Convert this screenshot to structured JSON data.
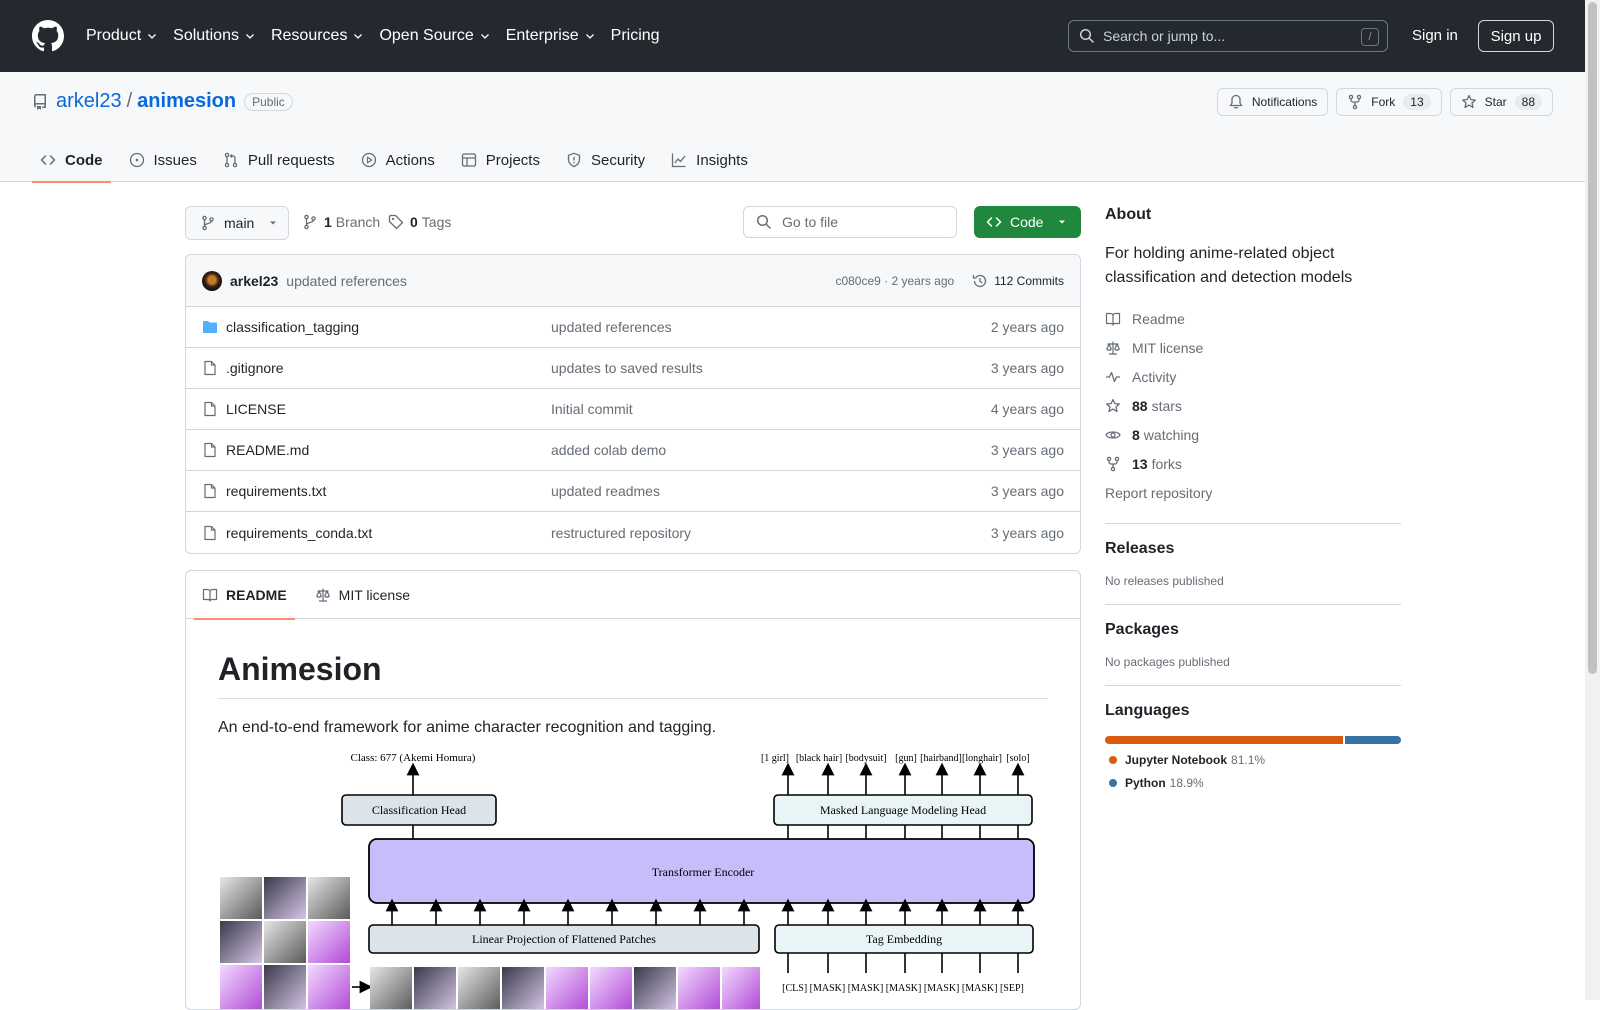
{
  "nav": {
    "items": [
      "Product",
      "Solutions",
      "Resources",
      "Open Source",
      "Enterprise",
      "Pricing"
    ],
    "search_placeholder": "Search or jump to...",
    "search_key": "/",
    "signin": "Sign in",
    "signup": "Sign up"
  },
  "repo": {
    "owner": "arkel23",
    "separator": "/",
    "name": "animesion",
    "visibility": "Public",
    "notifications_label": "Notifications",
    "fork_label": "Fork",
    "fork_count": "13",
    "star_label": "Star",
    "star_count": "88",
    "tabs": [
      "Code",
      "Issues",
      "Pull requests",
      "Actions",
      "Projects",
      "Security",
      "Insights"
    ]
  },
  "toolbar": {
    "branch": "main",
    "branch_count": "1",
    "branch_label": "Branch",
    "tag_count": "0",
    "tag_label": "Tags",
    "goto_placeholder": "Go to file",
    "code_label": "Code"
  },
  "commit": {
    "author": "arkel23",
    "message": "updated references",
    "hash_time": "c080ce9 · 2 years ago",
    "commits_label": "112 Commits"
  },
  "files": [
    {
      "name": "classification_tagging",
      "type": "folder",
      "message": "updated references",
      "age": "2 years ago"
    },
    {
      "name": ".gitignore",
      "type": "file",
      "message": "updates to saved results",
      "age": "3 years ago"
    },
    {
      "name": "LICENSE",
      "type": "file",
      "message": "Initial commit",
      "age": "4 years ago"
    },
    {
      "name": "README.md",
      "type": "file",
      "message": "added colab demo",
      "age": "3 years ago"
    },
    {
      "name": "requirements.txt",
      "type": "file",
      "message": "updated readmes",
      "age": "3 years ago"
    },
    {
      "name": "requirements_conda.txt",
      "type": "file",
      "message": "restructured repository",
      "age": "3 years ago"
    }
  ],
  "readme": {
    "tab_readme": "README",
    "tab_license": "MIT license",
    "title": "Animesion",
    "description": "An end-to-end framework for anime character recognition and tagging.",
    "figure": {
      "class_label": "Class: 677 (Akemi Homura)",
      "tags_top": [
        "[1 girl]",
        "[black hair]",
        "[bodysuit]",
        "[gun]",
        "[hairband]",
        "[longhair]",
        "[solo]"
      ],
      "classification_head": "Classification Head",
      "mlm_head": "Masked Language Modeling Head",
      "encoder": "Transformer Encoder",
      "linear_projection": "Linear Projection of Flattened Patches",
      "tag_embedding": "Tag Embedding",
      "tokens_bottom": "[CLS] [MASK] [MASK] [MASK] [MASK] [MASK] [SEP]"
    }
  },
  "about": {
    "heading": "About",
    "description": "For holding anime-related object classification and detection models",
    "readme": "Readme",
    "license": "MIT license",
    "activity": "Activity",
    "stars_count": "88",
    "stars_label": "stars",
    "watching_count": "8",
    "watching_label": "watching",
    "forks_count": "13",
    "forks_label": "forks",
    "report": "Report repository"
  },
  "releases": {
    "heading": "Releases",
    "text": "No releases published"
  },
  "packages": {
    "heading": "Packages",
    "text": "No packages published"
  },
  "languages": {
    "heading": "Languages",
    "items": [
      {
        "name": "Jupyter Notebook",
        "percent": "81.1%",
        "value": 81.1,
        "color": "#DA5B0B"
      },
      {
        "name": "Python",
        "percent": "18.9%",
        "value": 18.9,
        "color": "#3572A5"
      }
    ]
  }
}
